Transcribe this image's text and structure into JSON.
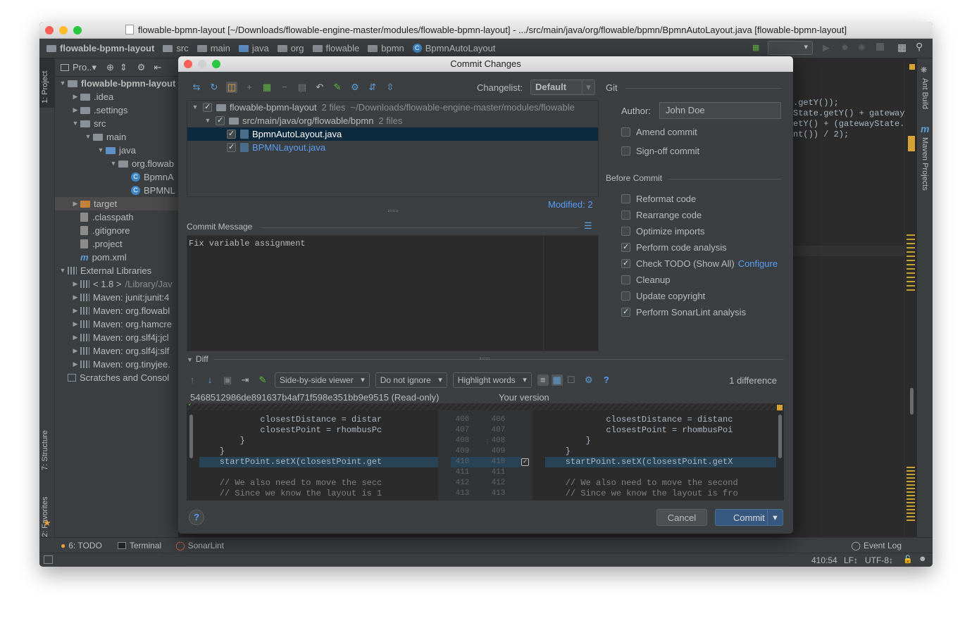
{
  "window": {
    "title": "flowable-bpmn-layout [~/Downloads/flowable-engine-master/modules/flowable-bpmn-layout] - .../src/main/java/org/flowable/bpmn/BpmnAutoLayout.java [flowable-bpmn-layout]"
  },
  "navbar": {
    "crumbs": [
      "flowable-bpmn-layout",
      "src",
      "main",
      "java",
      "org",
      "flowable",
      "bpmn",
      "BpmnAutoLayout"
    ]
  },
  "left_strip": {
    "project": "1: Project",
    "structure": "7: Structure",
    "favorites": "2: Favorites"
  },
  "right_strip": {
    "ant": "Ant Build",
    "maven": "Maven Projects",
    "maven_icon": "m"
  },
  "project_panel": {
    "header": "Pro..▾",
    "tree": [
      {
        "label": "flowable-bpmn-layout",
        "depth": 0,
        "tri": "▼",
        "kind": "folder",
        "bold": true
      },
      {
        "label": ".idea",
        "depth": 1,
        "tri": "▶",
        "kind": "folder"
      },
      {
        "label": ".settings",
        "depth": 1,
        "tri": "▶",
        "kind": "folder"
      },
      {
        "label": "src",
        "depth": 1,
        "tri": "▼",
        "kind": "folder"
      },
      {
        "label": "main",
        "depth": 2,
        "tri": "▼",
        "kind": "folder"
      },
      {
        "label": "java",
        "depth": 3,
        "tri": "▼",
        "kind": "folder-blue"
      },
      {
        "label": "org.flowab",
        "depth": 4,
        "tri": "▼",
        "kind": "folder"
      },
      {
        "label": "BpmnA",
        "depth": 5,
        "tri": "",
        "kind": "class"
      },
      {
        "label": "BPMNL",
        "depth": 5,
        "tri": "",
        "kind": "class"
      },
      {
        "label": "target",
        "depth": 1,
        "tri": "▶",
        "kind": "folder-orange",
        "selected": true
      },
      {
        "label": ".classpath",
        "depth": 1,
        "tri": "",
        "kind": "file"
      },
      {
        "label": ".gitignore",
        "depth": 1,
        "tri": "",
        "kind": "file"
      },
      {
        "label": ".project",
        "depth": 1,
        "tri": "",
        "kind": "file"
      },
      {
        "label": "pom.xml",
        "depth": 1,
        "tri": "",
        "kind": "maven"
      },
      {
        "label": "External Libraries",
        "depth": 0,
        "tri": "▼",
        "kind": "lib"
      },
      {
        "label": "< 1.8 >",
        "extra": "/Library/Jav",
        "depth": 1,
        "tri": "▶",
        "kind": "lib"
      },
      {
        "label": "Maven: junit:junit:4",
        "depth": 1,
        "tri": "▶",
        "kind": "lib"
      },
      {
        "label": "Maven: org.flowabl",
        "depth": 1,
        "tri": "▶",
        "kind": "lib"
      },
      {
        "label": "Maven: org.hamcre",
        "depth": 1,
        "tri": "▶",
        "kind": "lib"
      },
      {
        "label": "Maven: org.slf4j:jcl",
        "depth": 1,
        "tri": "▶",
        "kind": "lib"
      },
      {
        "label": "Maven: org.slf4j:slf",
        "depth": 1,
        "tri": "▶",
        "kind": "lib"
      },
      {
        "label": "Maven: org.tinyjee.",
        "depth": 1,
        "tri": "▶",
        "kind": "lib"
      },
      {
        "label": "Scratches and Consol",
        "depth": 0,
        "tri": "",
        "kind": "scratch"
      }
    ]
  },
  "editor_right": {
    "lines": [
      ".getY());",
      "State.getY() + gatewaySta",
      "etY() + (gatewayState.getH",
      "nt()) / 2);"
    ]
  },
  "dialog": {
    "title": "Commit Changes",
    "changelist_label": "Changelist:",
    "changelist_value": "Default",
    "git_label": "Git",
    "tree": {
      "root_label": "flowable-bpmn-layout",
      "root_count": "2 files",
      "root_path": "~/Downloads/flowable-engine-master/modules/flowable",
      "pkg_label": "src/main/java/org/flowable/bpmn",
      "pkg_count": "2 files",
      "file1": "BpmnAutoLayout.java",
      "file2": "BPMNLayout.java"
    },
    "modified": "Modified: 2",
    "commit_message_label": "Commit Message",
    "commit_message": "Fix variable assignment",
    "author_label": "Author:",
    "author_value": "John Doe",
    "amend": "Amend commit",
    "signoff": "Sign-off commit",
    "before_commit": "Before Commit",
    "options": [
      {
        "label": "Reformat code",
        "checked": false
      },
      {
        "label": "Rearrange code",
        "checked": false
      },
      {
        "label": "Optimize imports",
        "checked": false
      },
      {
        "label": "Perform code analysis",
        "checked": true
      },
      {
        "label": "Check TODO (Show All)",
        "checked": true
      },
      {
        "label": "Cleanup",
        "checked": false
      },
      {
        "label": "Update copyright",
        "checked": false
      },
      {
        "label": "Perform SonarLint analysis",
        "checked": true
      }
    ],
    "configure_link": "Configure",
    "diff_label": "Diff",
    "viewer_combo": "Side-by-side viewer",
    "ignore_combo": "Do not ignore",
    "highlight_combo": "Highlight words",
    "difference_count": "1 difference",
    "left_header": "5468512986de891637b4af71f598e351bb9e9515 (Read-only)",
    "right_header": "Your version",
    "left_code": [
      "            closestDistance = distar",
      "            closestPoint = rhombusPc",
      "        }",
      "    }",
      "    startPoint.setX(closestPoint.get",
      "",
      "    // We also need to move the secc",
      "    // Since we know the layout is 1"
    ],
    "right_code": [
      "            closestDistance = distanc",
      "            closestPoint = rhombusPoi",
      "        }",
      "    }",
      "    startPoint.setX(closestPoint.getX",
      "",
      "    // We also need to move the second",
      "    // Since we know the layout is fro"
    ],
    "line_numbers": [
      "406",
      "407",
      "408",
      "409",
      "410",
      "411",
      "412",
      "413"
    ],
    "cancel_label": "Cancel",
    "commit_label": "Commit",
    "help_label": "?"
  },
  "bottom_tools": {
    "todo": "6: TODO",
    "terminal": "Terminal",
    "sonarlint": "SonarLint",
    "event_log": "Event Log"
  },
  "status": {
    "position": "410:54",
    "line_sep": "LF↕",
    "encoding": "UTF-8↕"
  },
  "colors": {
    "accent": "#365880",
    "link": "#589df6",
    "selection": "#0d293e",
    "diff_change": "#294356"
  }
}
